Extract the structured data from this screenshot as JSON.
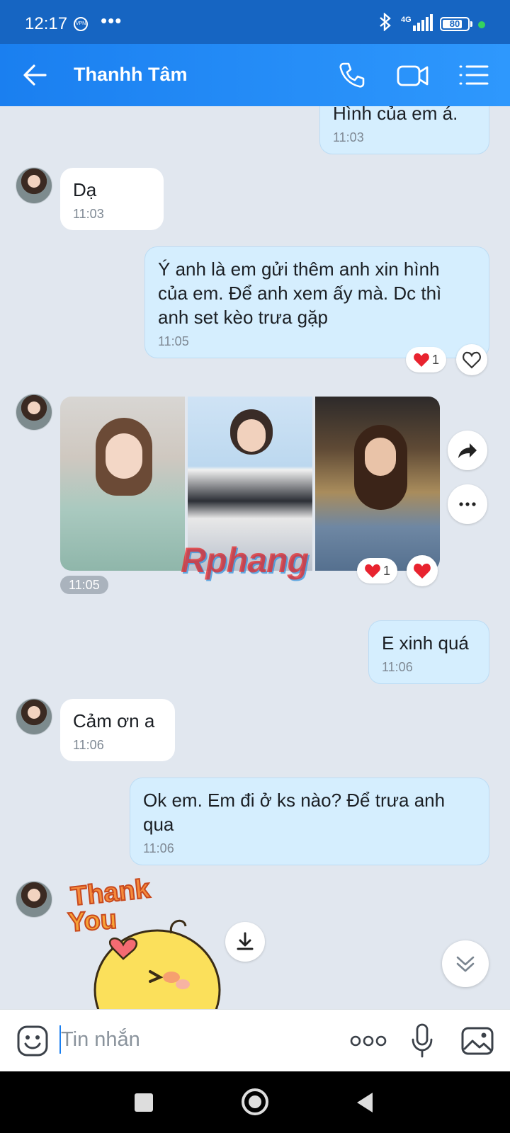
{
  "status_bar": {
    "time": "12:17",
    "network": "4G",
    "battery": "80",
    "battery_level": 0.8
  },
  "header": {
    "contact_name": "Thanhh Tâm"
  },
  "messages": [
    {
      "text": "Hình của em á.",
      "time": "11:03"
    },
    {
      "text": "Dạ",
      "time": "11:03"
    },
    {
      "line1": "Ý anh là em gửi thêm anh xin hình",
      "line2": "của em. Để anh xem ấy mà. Dc thì",
      "line3": "anh set kèo trưa gặp",
      "time": "11:05",
      "reaction_count": "1"
    },
    {
      "time": "11:05",
      "reaction_count": "1"
    },
    {
      "text": "E xinh quá",
      "time": "11:06"
    },
    {
      "text": "Cảm ơn a",
      "time": "11:06"
    },
    {
      "line1": "Ok em. Em đi ở ks nào? Để trưa anh",
      "line2": "qua",
      "time": "11:06"
    },
    {
      "sticker_line1": "Thank",
      "sticker_line2": "You"
    }
  ],
  "watermark": "Rphang",
  "composer": {
    "placeholder": "Tin nhắn"
  },
  "colors": {
    "header": "#1a7ff0",
    "status_bar": "#1665c2",
    "outgoing_bubble": "#d5eefe",
    "incoming_bubble": "#ffffff",
    "chat_bg": "#e1e7ef"
  }
}
